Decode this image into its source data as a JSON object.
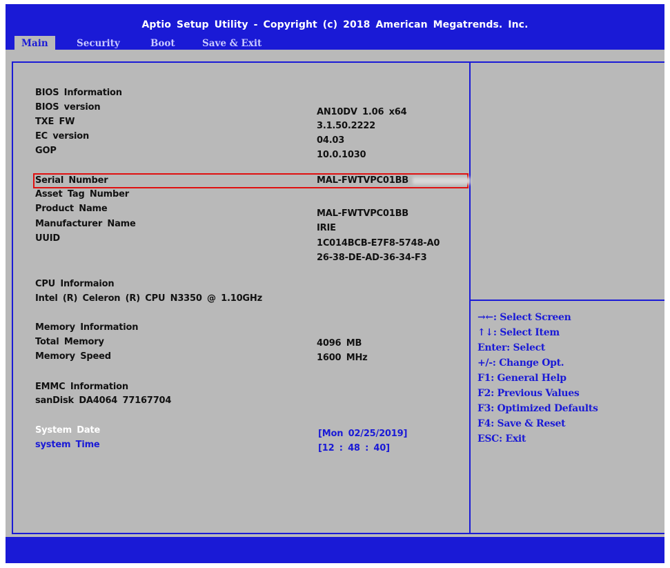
{
  "header": {
    "title": "Aptio Setup Utility - Copyright (c) 2018 American Megatrends. Inc."
  },
  "tabs": [
    {
      "label": "Main",
      "active": true
    },
    {
      "label": "Security",
      "active": false
    },
    {
      "label": "Boot",
      "active": false
    },
    {
      "label": "Save & Exit",
      "active": false
    }
  ],
  "main": {
    "bios_heading": "BIOS Information",
    "bios_version_label": "BIOS version",
    "bios_version_value": "AN10DV 1.06 x64",
    "txe_fw_label": "TXE FW",
    "txe_fw_value": "3.1.50.2222",
    "ec_version_label": "EC version",
    "ec_version_value": "04.03",
    "gop_label": "GOP",
    "gop_value": "10.0.1030",
    "serial_label": "Serial Number",
    "serial_value": "MAL-FWTVPC01BB",
    "asset_tag_label": "Asset Tag Number",
    "product_name_label": "Product Name",
    "product_name_value": "MAL-FWTVPC01BB",
    "manufacturer_label": "Manufacturer Name",
    "manufacturer_value": "IRIE",
    "uuid_label": "UUID",
    "uuid_value_line1": "1C014BCB-E7F8-5748-A0",
    "uuid_value_line2": "26-38-DE-AD-36-34-F3",
    "cpu_heading": "CPU Informaion",
    "cpu_name": "Intel (R) Celeron (R) CPU N3350 @ 1.10GHz",
    "memory_heading": "Memory Information",
    "total_memory_label": "Total Memory",
    "total_memory_value": "4096 MB",
    "memory_speed_label": "Memory Speed",
    "memory_speed_value": "1600 MHz",
    "emmc_heading": "EMMC Information",
    "emmc_device": "sanDisk DA4064 77167704",
    "system_date_label": "System Date",
    "system_date_value": "[Mon 02/25/2019]",
    "system_time_label": "system Time",
    "system_time_value": "[12 : 48 : 40]"
  },
  "help": {
    "items": [
      "→←: Select Screen",
      "↑↓: Select Item",
      "Enter: Select",
      "+/-: Change Opt.",
      "F1: General Help",
      "F2: Previous Values",
      "F3: Optimized Defaults",
      "F4: Save & Reset",
      "ESC: Exit"
    ]
  },
  "colors": {
    "bios_blue": "#1a1ad6",
    "background_gray": "#b9b9b9",
    "highlight_red": "#e01010"
  }
}
